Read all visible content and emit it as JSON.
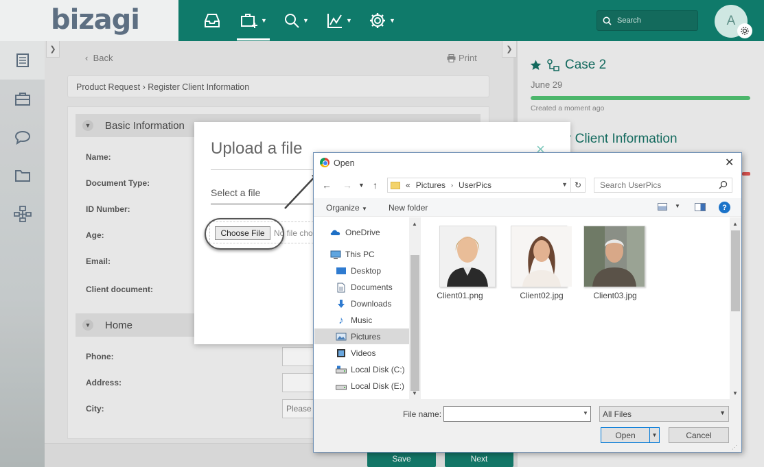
{
  "app": {
    "logo": "bizagi",
    "search_placeholder": "Search",
    "avatar_initial": "A",
    "nav_icons": [
      "inbox-icon",
      "new-case-icon",
      "search-icon",
      "reports-icon",
      "settings-icon"
    ],
    "accent_color": "#0f7a6a"
  },
  "sidebar": {
    "icons": [
      "workitems-icon",
      "cases-icon",
      "chat-icon",
      "folder-icon",
      "process-icon"
    ]
  },
  "main": {
    "back_label": "Back",
    "print_label": "Print",
    "breadcrumb": "Product Request › Register Client Information",
    "sections": [
      {
        "title": "Basic Information"
      },
      {
        "title": "Home"
      }
    ],
    "basic_fields": [
      "Name:",
      "Document Type:",
      "ID Number:",
      "Age:",
      "Email:",
      "Client document:"
    ],
    "home_fields": [
      "Phone:",
      "Address:",
      "City:"
    ],
    "city_value": "Please",
    "save_label": "Save",
    "next_label": "Next"
  },
  "case_panel": {
    "title": "Case 2",
    "date": "June 29",
    "progress": 1.0,
    "progress_color": "#4cbf6e",
    "created": "Created a moment ago",
    "task_title": "r Client Information"
  },
  "upload_modal": {
    "title": "Upload a file",
    "close_label": "×",
    "select_label": "Select a file",
    "choose_file_label": "Choose File",
    "no_file_label": "No file chosen"
  },
  "open_dialog": {
    "title": "Open",
    "close_label": "✕",
    "address_prefix": "«",
    "address_parts": [
      "Pictures",
      "UserPics"
    ],
    "search_placeholder": "Search UserPics",
    "organize_label": "Organize",
    "new_folder_label": "New folder",
    "nav_items": [
      {
        "label": "OneDrive",
        "icon": "onedrive-icon"
      },
      {
        "label": "This PC",
        "icon": "pc-icon"
      },
      {
        "label": "Desktop",
        "icon": "desktop-icon"
      },
      {
        "label": "Documents",
        "icon": "documents-icon"
      },
      {
        "label": "Downloads",
        "icon": "downloads-icon"
      },
      {
        "label": "Music",
        "icon": "music-icon"
      },
      {
        "label": "Pictures",
        "icon": "pictures-icon",
        "selected": true
      },
      {
        "label": "Videos",
        "icon": "videos-icon"
      },
      {
        "label": "Local Disk (C:)",
        "icon": "disk-icon"
      },
      {
        "label": "Local Disk (E:)",
        "icon": "disk-icon"
      }
    ],
    "files": [
      {
        "name": "Client01.png"
      },
      {
        "name": "Client02.jpg"
      },
      {
        "name": "Client03.jpg"
      }
    ],
    "file_name_label": "File name:",
    "file_name_value": "",
    "filter_label": "All Files",
    "open_label": "Open",
    "cancel_label": "Cancel"
  }
}
